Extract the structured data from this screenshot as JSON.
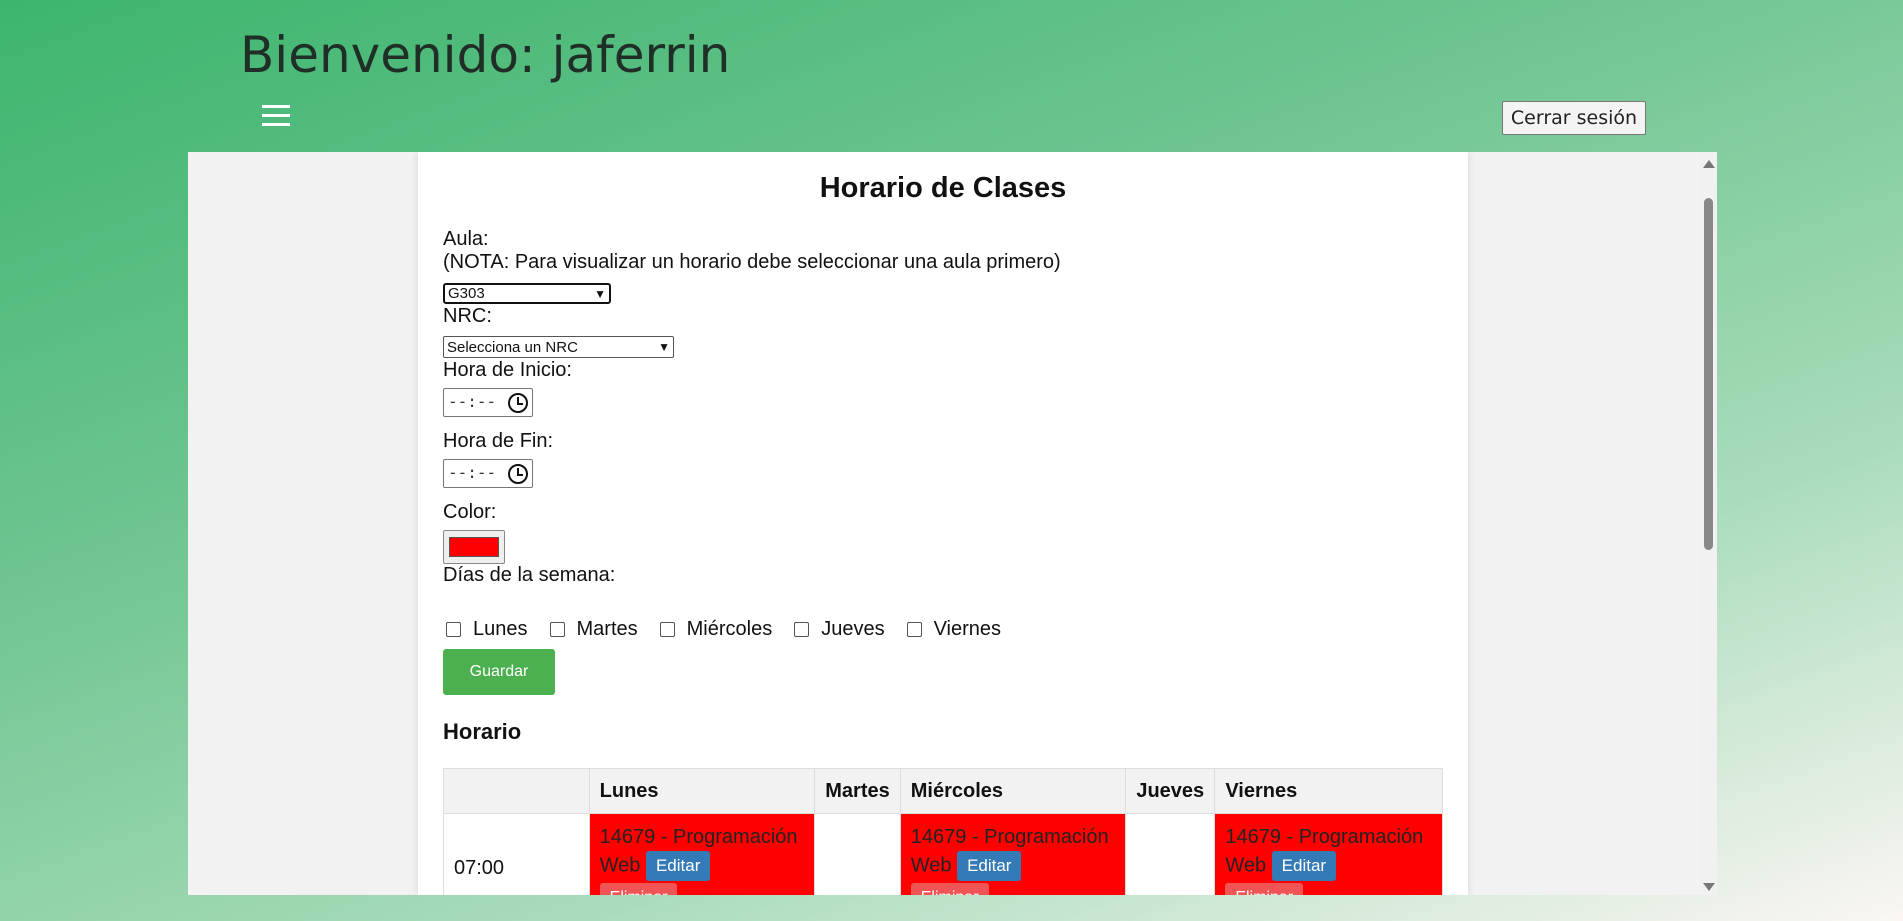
{
  "header": {
    "welcome": "Bienvenido: jaferrin",
    "menu_icon": "hamburger-menu-icon",
    "logout_label": "Cerrar sesión"
  },
  "form": {
    "title": "Horario de Clases",
    "aula_label": "Aula:",
    "aula_note": "(NOTA: Para visualizar un horario debe seleccionar una aula primero)",
    "aula_value": "G303",
    "nrc_label": "NRC:",
    "nrc_value": "Selecciona un NRC",
    "start_label": "Hora de Inicio:",
    "start_value": "--:--",
    "end_label": "Hora de Fin:",
    "end_value": "--:--",
    "color_label": "Color:",
    "color_value": "#ff0000",
    "days_label": "Días de la semana:",
    "days": [
      {
        "label": "Lunes",
        "checked": false
      },
      {
        "label": "Martes",
        "checked": false
      },
      {
        "label": "Miércoles",
        "checked": false
      },
      {
        "label": "Jueves",
        "checked": false
      },
      {
        "label": "Viernes",
        "checked": false
      }
    ],
    "save_label": "Guardar"
  },
  "schedule": {
    "title": "Horario",
    "headers": [
      "",
      "Lunes",
      "Martes",
      "Miércoles",
      "Jueves",
      "Viernes"
    ],
    "row_time": "07:00",
    "event_text": "14679 - Programación Web",
    "edit_label": "Editar",
    "delete_label": "Eliminar"
  }
}
